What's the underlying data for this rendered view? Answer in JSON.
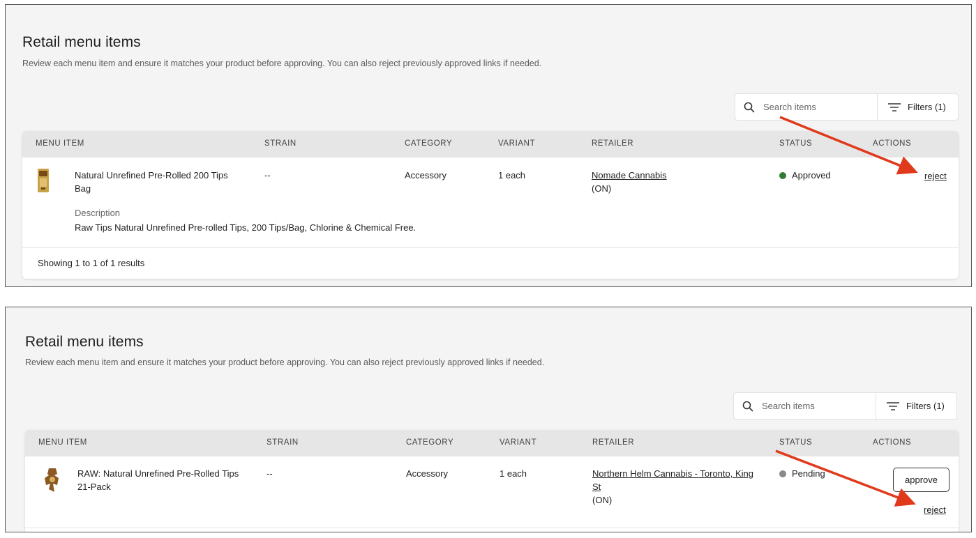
{
  "colors": {
    "approved": "#2e7d32",
    "pending": "#888888",
    "arrow": "#e0391b",
    "header_bg": "#e6e6e6",
    "page_bg": "#f4f4f4"
  },
  "panels": [
    {
      "title": "Retail menu items",
      "subtitle": "Review each menu item and ensure it matches your product before approving. You can also reject previously approved links if needed.",
      "search": {
        "placeholder": "Search items",
        "icon": "search-icon"
      },
      "filters_label": "Filters (1)",
      "columns": [
        "MENU ITEM",
        "STRAIN",
        "CATEGORY",
        "VARIANT",
        "RETAILER",
        "STATUS",
        "ACTIONS"
      ],
      "row": {
        "name": "Natural Unrefined Pre-Rolled 200 Tips Bag",
        "strain": "--",
        "category": "Accessory",
        "variant": "1 each",
        "retailer": "Nomade Cannabis",
        "province": "(ON)",
        "status": "Approved",
        "action": "reject",
        "description_label": "Description",
        "description": "Raw Tips Natural Unrefined Pre-rolled Tips, 200 Tips/Bag, Chlorine & Chemical Free."
      },
      "footer": "Showing 1 to 1 of 1 results"
    },
    {
      "title": "Retail menu items",
      "subtitle": "Review each menu item and ensure it matches your product before approving. You can also reject previously approved links if needed.",
      "search": {
        "placeholder": "Search items",
        "icon": "search-icon"
      },
      "filters_label": "Filters (1)",
      "columns": [
        "MENU ITEM",
        "STRAIN",
        "CATEGORY",
        "VARIANT",
        "RETAILER",
        "STATUS",
        "ACTIONS"
      ],
      "row": {
        "name": "RAW: Natural Unrefined Pre-Rolled Tips 21-Pack",
        "strain": "--",
        "category": "Accessory",
        "variant": "1 each",
        "retailer": "Northern Helm Cannabis - Toronto, King St",
        "province": "(ON)",
        "status": "Pending",
        "approve_label": "approve",
        "action": "reject"
      }
    }
  ]
}
